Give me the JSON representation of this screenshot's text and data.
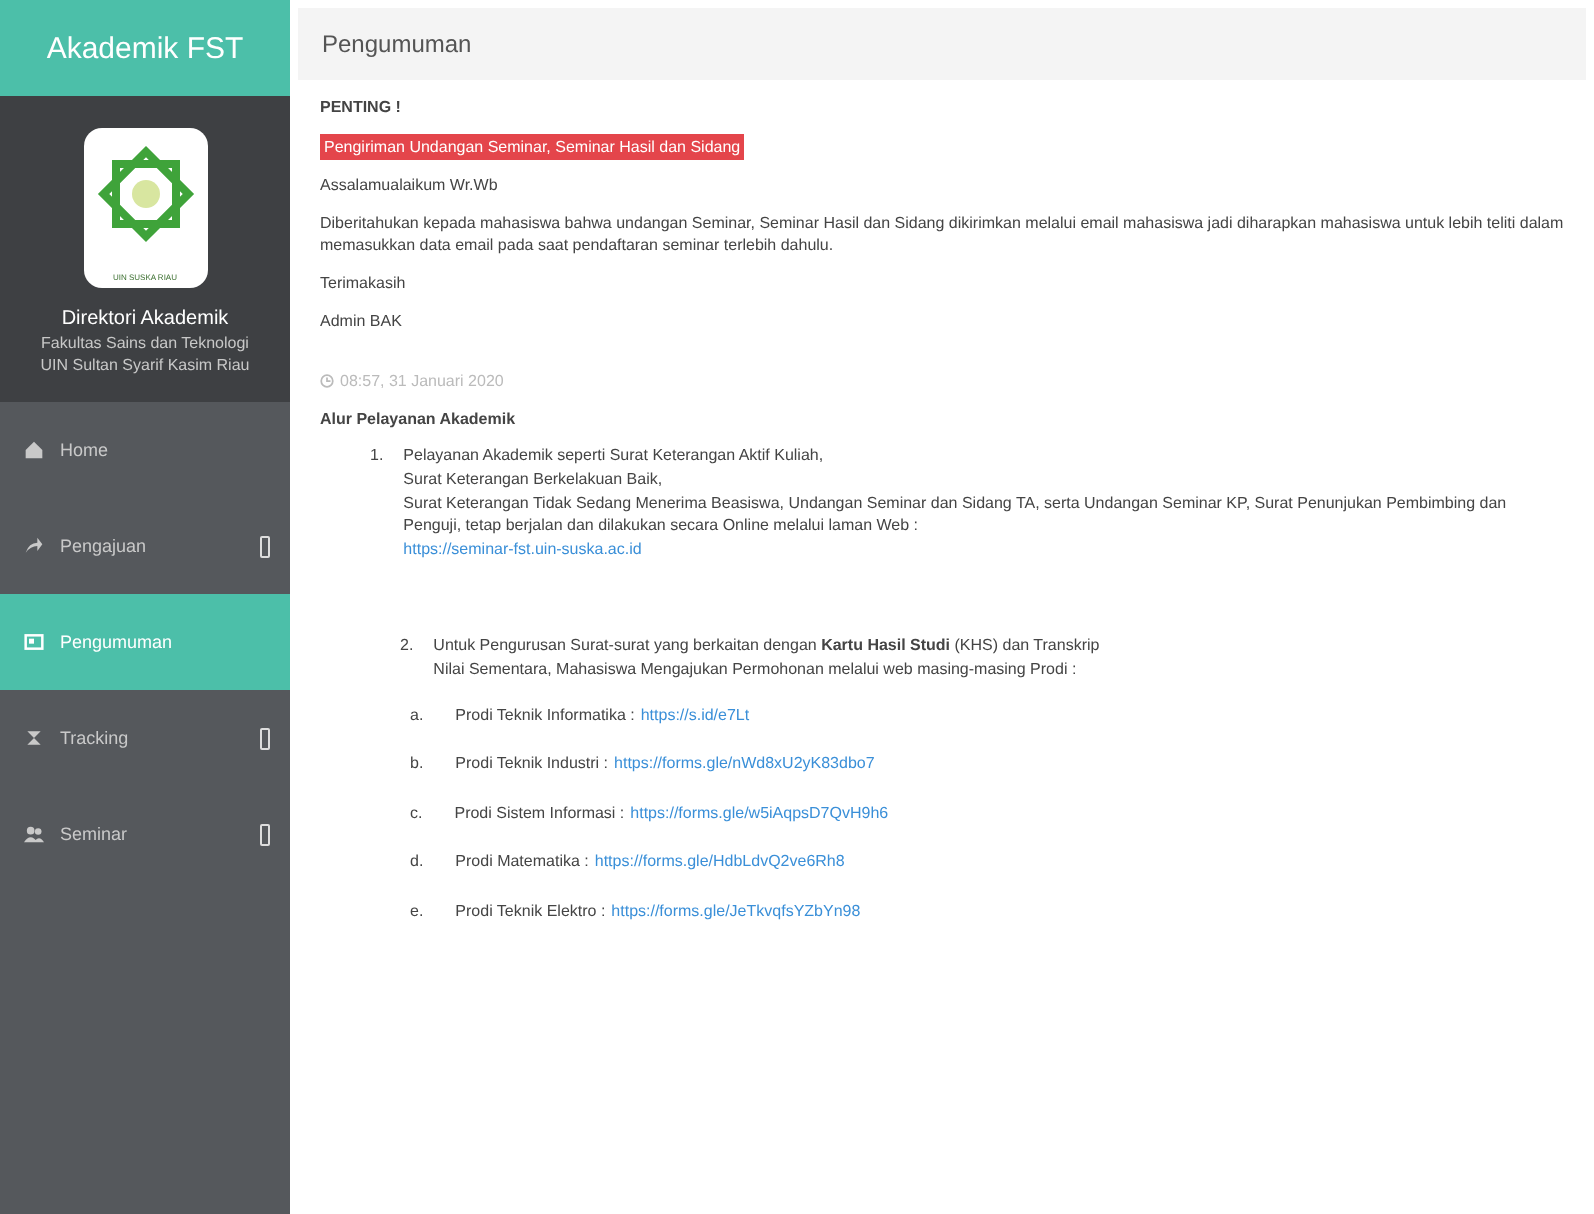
{
  "sidebar": {
    "title": "Akademik FST",
    "logo_caption": "UIN SUSKA RIAU",
    "profile": {
      "name": "Direktori Akademik",
      "lines": [
        "Fakultas Sains dan Teknologi",
        "UIN Sultan Syarif Kasim Riau"
      ]
    },
    "items": [
      {
        "label": "Home",
        "kind": "home",
        "expandable": false,
        "selected": false
      },
      {
        "label": "Pengajuan",
        "kind": "send",
        "expandable": true,
        "selected": false
      },
      {
        "label": "Pengumuman",
        "kind": "news",
        "expandable": false,
        "selected": true
      },
      {
        "label": "Tracking",
        "kind": "track",
        "expandable": true,
        "selected": false
      },
      {
        "label": "Seminar",
        "kind": "people",
        "expandable": true,
        "selected": false
      }
    ]
  },
  "page": {
    "title": "Pengumuman",
    "notice": {
      "heading": "PENTING !",
      "highlight": "Pengiriman Undangan Seminar, Seminar Hasil dan Sidang",
      "greeting": "Assalamualaikum Wr.Wb",
      "body": "Diberitahukan kepada mahasiswa bahwa undangan Seminar, Seminar Hasil dan Sidang dikirimkan melalui email mahasiswa jadi diharapkan mahasiswa untuk lebih teliti dalam memasukkan data email pada saat pendaftaran seminar terlebih dahulu.",
      "thanks": "Terimakasih",
      "signature": "Admin BAK",
      "date": "08:57, 31 Januari 2020"
    },
    "flow": {
      "heading": "Alur Pelayanan Akademik",
      "steps": [
        {
          "number": "1.",
          "lines": [
            "Pelayanan Akademik seperti Surat Keterangan Aktif Kuliah,",
            "Surat Keterangan Berkelakuan Baik,",
            "Surat Keterangan Tidak Sedang Menerima Beasiswa, Undangan Seminar dan Sidang TA, serta Undangan Seminar KP, Surat Penunjukan Pembimbing dan Penguji, tetap berjalan dan dilakukan secara Online melalui laman Web :"
          ],
          "link": "https://seminar-fst.uin-suska.ac.id"
        },
        {
          "number": "2.",
          "lines": [
            "Untuk Pengurusan Surat-surat yang berkaitan dengan **Kartu Hasil Studi** (KHS) dan Transkrip Nilai Sementara, Mahasiswa Mengajukan Permohonan melalui web masing-masing Prodi :"
          ]
        }
      ],
      "prodi": [
        {
          "marker": "a.",
          "label": "Prodi Teknik Informatika :",
          "link": "https://s.id/e7Lt"
        },
        {
          "marker": "b.",
          "label": "Prodi Teknik Industri :",
          "link": "https://forms.gle/nWd8xU2yK83dbo7"
        },
        {
          "marker": "c.",
          "label": "Prodi Sistem Informasi :",
          "link": "https://forms.gle/w5iAqpsD7QvH9h6"
        },
        {
          "marker": "d.",
          "label": "Prodi Matematika :",
          "link": "https://forms.gle/HdbLdvQ2ve6Rh8"
        },
        {
          "marker": "e.",
          "label": "Prodi Teknik Elektro :",
          "link": "https://forms.gle/JeTkvqfsYZbYn98"
        }
      ]
    }
  }
}
